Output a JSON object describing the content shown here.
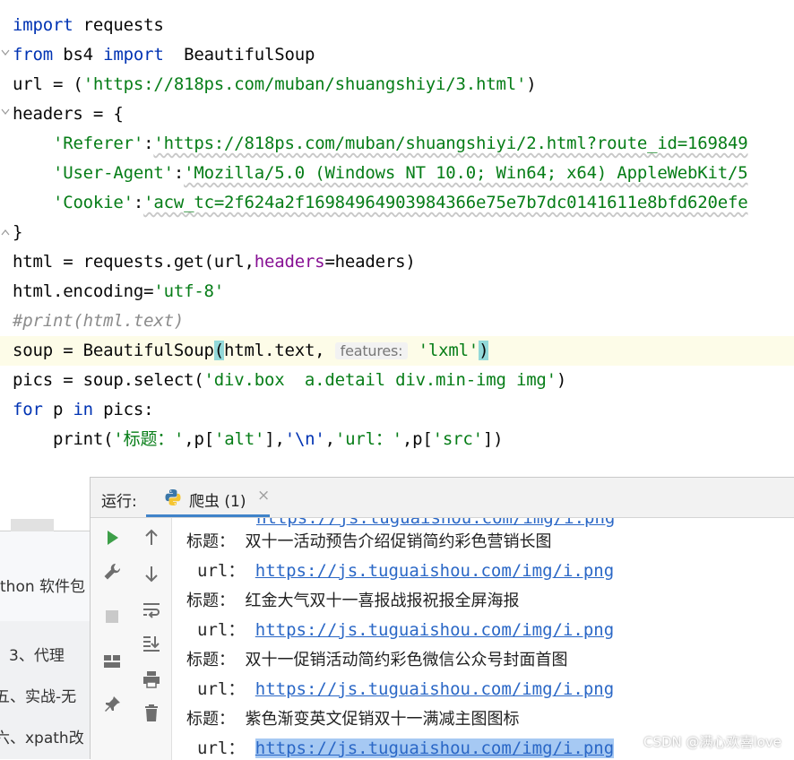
{
  "editor": {
    "lines": [
      {
        "kw1": "import",
        "rest": " requests"
      },
      {
        "kw1": "from",
        "mid": " bs4 ",
        "kw2": "import",
        "rest": "  BeautifulSoup"
      },
      {
        "pre": "url = (",
        "str": "'https://818ps.com/muban/shuangshiyi/3.html'",
        "post": ")"
      },
      {
        "text": "headers = {"
      },
      {
        "indent": "    ",
        "key": "'Referer'",
        "sep": ":",
        "val": "'https://818ps.com/muban/shuangshiyi/2.html?route_id=169849"
      },
      {
        "indent": "    ",
        "key": "'User-Agent'",
        "sep": ":",
        "val": "'Mozilla/5.0 (Windows NT 10.0; Win64; x64) AppleWebKit/5"
      },
      {
        "indent": "    ",
        "key": "'Cookie'",
        "sep": ":",
        "val": "'acw_tc=2f624a2f16984964903984366e75e7b7dc0141611e8bfd620efe"
      },
      {
        "text": "}"
      },
      {
        "pre": "html = requests.get(url,",
        "param": "headers",
        "post": "=headers)"
      },
      {
        "pre": "html.encoding=",
        "str": "'utf-8'"
      },
      {
        "cmt": "#print(html.text)"
      },
      {
        "pre": "soup = BeautifulSoup",
        "open": "(",
        "mid": "html.text, ",
        "hint": "features:",
        "str": " 'lxml'",
        "close": ")"
      },
      {
        "pre": "pics = soup.select(",
        "str": "'div.box  a.detail div.min-img img'",
        "post": ")"
      },
      {
        "kw1": "for",
        "mid": " p ",
        "kw2": "in",
        "rest": " pics:"
      },
      {
        "indent": "    ",
        "pre": "print(",
        "s1": "'标题：'",
        "m1": ",p[",
        "s2": "'alt'",
        "m2": "],",
        "s3": "'\\n'",
        "m3": ",",
        "s4": "'url：'",
        "m4": ",p[",
        "s5": "'src'",
        "m5": "])"
      }
    ]
  },
  "behind": {
    "items": [
      "thon 软件包",
      "3、代理",
      "五、实战-无",
      "六、xpath改"
    ]
  },
  "run_panel": {
    "label": "运行:",
    "tab_name": "爬虫 (1)",
    "tab_close": "×",
    "partial_top": "https://js.tuguaishou.com/img/i.png",
    "entries": [
      {
        "title_label": "标题：",
        "title": "双十一活动预告介绍促销简约彩色营销长图",
        "url_label": "url：",
        "url": "https://js.tuguaishou.com/img/i.png"
      },
      {
        "title_label": "标题：",
        "title": "红金大气双十一喜报战报祝报全屏海报",
        "url_label": "url：",
        "url": "https://js.tuguaishou.com/img/i.png"
      },
      {
        "title_label": "标题：",
        "title": "双十一促销活动简约彩色微信公众号封面首图",
        "url_label": "url：",
        "url": "https://js.tuguaishou.com/img/i.png"
      },
      {
        "title_label": "标题：",
        "title": "紫色渐变英文促销双十一满减主图图标",
        "url_label": "url：",
        "url": "https://js.tuguaishou.com/img/i.png"
      }
    ]
  },
  "watermark": "CSDN @满心欢喜love",
  "colors": {
    "keyword": "#0033b3",
    "string": "#067d17",
    "param": "#871094",
    "comment": "#8c8c8c",
    "link": "#2a67c6",
    "tab_accent": "#4083c9"
  }
}
